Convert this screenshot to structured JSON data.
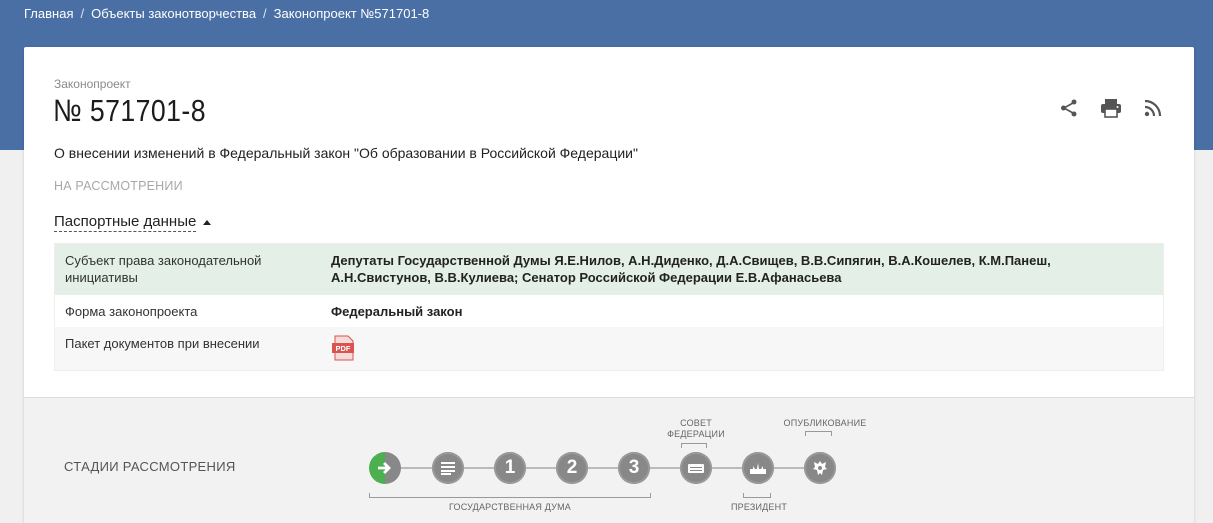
{
  "breadcrumb": {
    "home": "Главная",
    "objects": "Объекты законотворчества",
    "current": "Законопроект №571701-8"
  },
  "bill": {
    "kind": "Законопроект",
    "number": "№ 571701-8",
    "title": "О внесении изменений в Федеральный закон \"Об образовании в Российской Федерации\"",
    "status": "НА РАССМОТРЕНИИ"
  },
  "actions": {
    "share_icon": "share-icon",
    "print_icon": "print-icon",
    "rss_icon": "rss-icon"
  },
  "passport": {
    "toggle_label": "Паспортные данные",
    "rows": [
      {
        "key": "Субъект права законодательной инициативы",
        "value": "Депутаты Государственной Думы Я.Е.Нилов, А.Н.Диденко, Д.А.Свищев, В.В.Сипягин, В.А.Кошелев, К.М.Панеш, А.Н.Свистунов, В.В.Кулиева; Сенатор Российской Федерации Е.В.Афанасьева"
      },
      {
        "key": "Форма законопроекта",
        "value": "Федеральный закон"
      },
      {
        "key": "Пакет документов при внесении",
        "value": "PDF"
      }
    ]
  },
  "stages": {
    "label": "СТАДИИ РАССМОТРЕНИЯ",
    "steps": [
      "",
      "",
      "1",
      "2",
      "3",
      "",
      "",
      ""
    ],
    "labels": {
      "council": "СОВЕТ\nФЕДЕРАЦИИ",
      "publication": "ОПУБЛИКОВАНИЕ",
      "duma": "ГОСУДАРСТВЕННАЯ ДУМА",
      "president": "ПРЕЗИДЕНТ"
    }
  },
  "colors": {
    "header_blue": "#4a6fa5",
    "highlight_row": "#e3efe7",
    "stage_active": "#4caf50",
    "stage_default": "#888888"
  }
}
